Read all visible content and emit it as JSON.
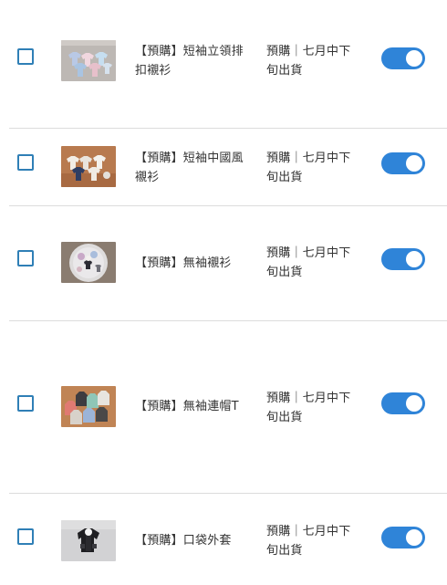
{
  "products": [
    {
      "name": "【預購】短袖立領排扣襯衫",
      "status": "預購｜七月中下旬出貨",
      "thumbnail_icon": "shirts-on-grey-photo",
      "enabled": true,
      "toggle_color": "#2f84d8"
    },
    {
      "name": "【預購】短袖中國風襯衫",
      "status": "預購｜七月中下旬出貨",
      "thumbnail_icon": "shirts-on-wood-photo",
      "enabled": true,
      "toggle_color": "#2f84d8"
    },
    {
      "name": "【預購】無袖襯衫",
      "status": "預購｜七月中下旬出貨",
      "thumbnail_icon": "plate-photo",
      "enabled": true,
      "toggle_color": "#2f84d8"
    },
    {
      "name": "【預購】無袖連帽T",
      "status": "預購｜七月中下旬出貨",
      "thumbnail_icon": "hoodies-on-wood-photo",
      "enabled": true,
      "toggle_color": "#2f84d8"
    },
    {
      "name": "【預購】口袋外套",
      "status": "預購｜七月中下旬出貨",
      "thumbnail_icon": "jacket-photo",
      "enabled": true,
      "toggle_color": "#2f84d8"
    }
  ],
  "colors": {
    "checkbox_border": "#2f7fb6",
    "toggle_on": "#2f84d8",
    "divider": "#dcdcdc"
  }
}
